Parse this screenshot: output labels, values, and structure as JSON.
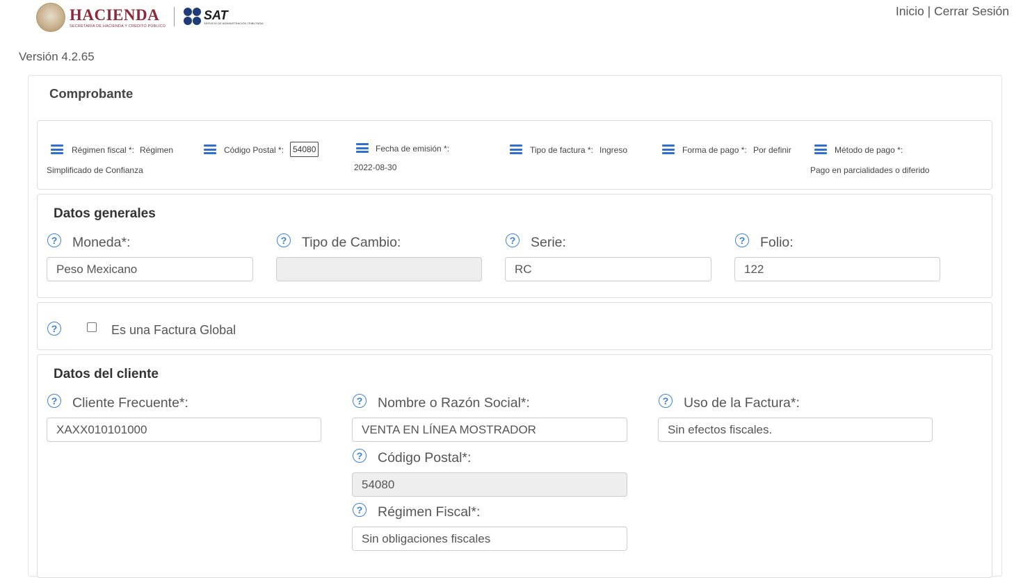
{
  "header": {
    "hacienda_title": "HACIENDA",
    "hacienda_subtitle": "SECRETARÍA DE HACIENDA Y CRÉDITO PÚBLICO",
    "sat_title": "SAT",
    "sat_subtitle": "SERVICIO DE ADMINISTRACIÓN TRIBUTARIA",
    "nav": {
      "inicio": "Inicio",
      "separator": "|",
      "cerrar_sesion": "Cerrar Sesión"
    }
  },
  "version": "Versión 4.2.65",
  "comprobante": {
    "title": "Comprobante",
    "summary": {
      "regimen_label": "Régimen fiscal *:",
      "regimen_value_1": "Régimen",
      "regimen_value_2": "Simplificado de Confianza",
      "cp_label": "Código Postal *:",
      "cp_value": "54080",
      "fecha_label": "Fecha de emisión *:",
      "fecha_value": "2022-08-30",
      "tipo_label": "Tipo de factura *:",
      "tipo_value": "Ingreso",
      "forma_label": "Forma de pago *:",
      "forma_value": "Por definir",
      "metodo_label": "Método de pago *:",
      "metodo_value": "Pago en parcialidades o diferido"
    }
  },
  "datos_generales": {
    "title": "Datos generales",
    "moneda": {
      "label": "Moneda*:",
      "value": "Peso Mexicano"
    },
    "tipo_cambio": {
      "label": "Tipo de Cambio:",
      "value": ""
    },
    "serie": {
      "label": "Serie:",
      "value": "RC"
    },
    "folio": {
      "label": "Folio:",
      "value": "122"
    }
  },
  "factura_global": {
    "label": "Es una Factura Global",
    "checked": false
  },
  "datos_cliente": {
    "title": "Datos del cliente",
    "cliente_frecuente": {
      "label": "Cliente Frecuente*:",
      "value": "XAXX010101000"
    },
    "nombre": {
      "label": "Nombre o Razón Social*:",
      "value": "VENTA EN LÍNEA MOSTRADOR"
    },
    "uso_factura": {
      "label": "Uso de la Factura*:",
      "value": "Sin efectos fiscales."
    },
    "codigo_postal": {
      "label": "Código Postal*:",
      "value": "54080"
    },
    "regimen_fiscal": {
      "label": "Régimen Fiscal*:",
      "value": "Sin obligaciones fiscales"
    }
  },
  "icons": {
    "help": "question-circle-icon",
    "menu": "hamburger-icon"
  },
  "colors": {
    "accent": "#3a80d9",
    "hacienda": "#8b2a3b",
    "sat": "#1e3c78"
  }
}
